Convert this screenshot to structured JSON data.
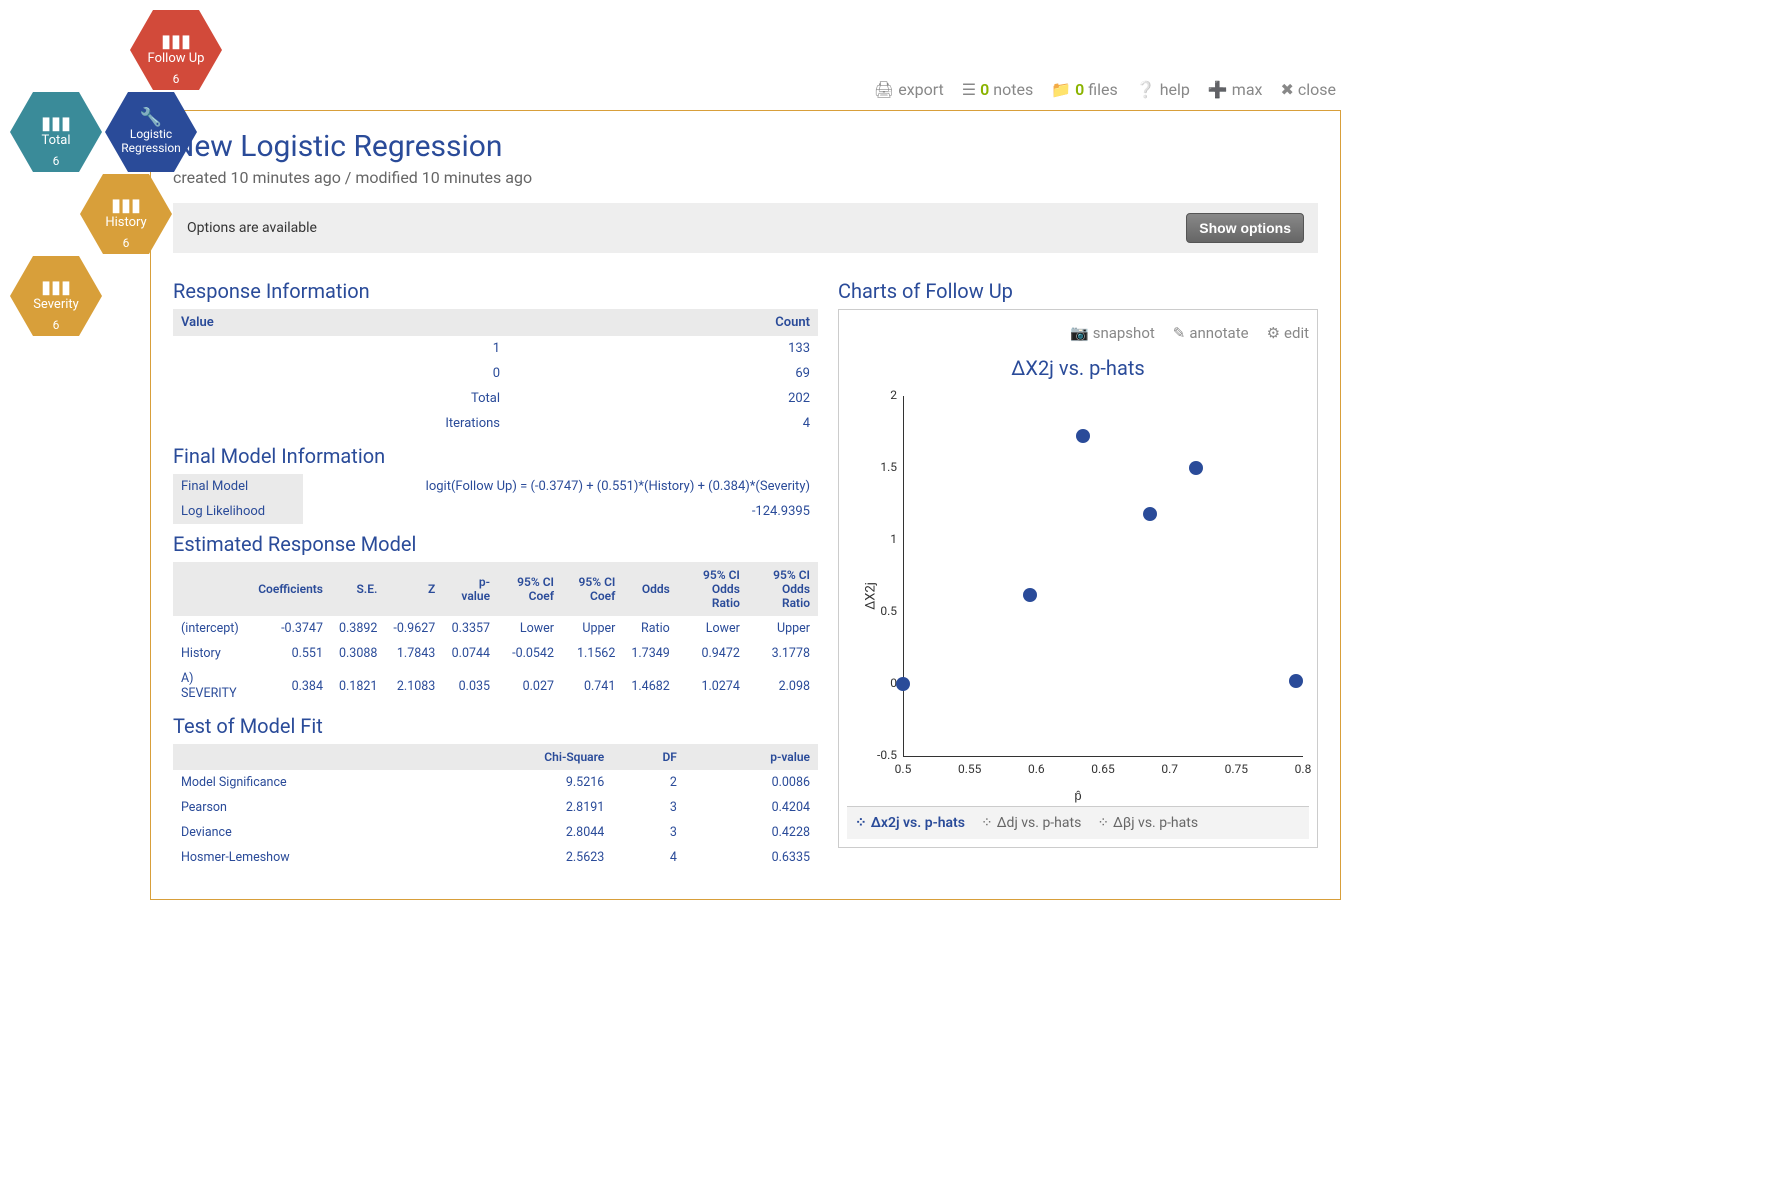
{
  "hex": {
    "followup": {
      "label": "Follow Up",
      "count": "6"
    },
    "total": {
      "label": "Total",
      "count": "6"
    },
    "logreg": {
      "label": "Logistic Regression"
    },
    "history": {
      "label": "History",
      "count": "6"
    },
    "severity": {
      "label": "Severity",
      "count": "6"
    }
  },
  "toolbar": {
    "export": "export",
    "notes_pre": "0",
    "notes": "notes",
    "files_pre": "0",
    "files": "files",
    "help": "help",
    "max": "max",
    "close": "close"
  },
  "title": "New Logistic Regression",
  "meta": "created 10 minutes ago / modified 10 minutes ago",
  "options_text": "Options are available",
  "show_options": "Show options",
  "sections": {
    "response": "Response Information",
    "final_model": "Final Model Information",
    "est": "Estimated Response Model",
    "fit": "Test of Model Fit",
    "charts": "Charts of Follow Up"
  },
  "response_info": {
    "headers": {
      "value": "Value",
      "count": "Count"
    },
    "rows": [
      {
        "value": "1",
        "count": "133"
      },
      {
        "value": "0",
        "count": "69"
      },
      {
        "value": "Total",
        "count": "202"
      },
      {
        "value": "Iterations",
        "count": "4"
      }
    ]
  },
  "final_model": {
    "fm_label": "Final Model",
    "fm_value": "logit(Follow Up) = (-0.3747) + (0.551)*(History) + (0.384)*(Severity)",
    "ll_label": "Log Likelihood",
    "ll_value": "-124.9395"
  },
  "est_headers": [
    "",
    "Coefficients",
    "S.E.",
    "Z",
    "p-value",
    "95% CI Coef",
    "95% CI Coef",
    "Odds",
    "95% CI Odds Ratio",
    "95% CI Odds Ratio"
  ],
  "est_rows": [
    [
      "(intercept)",
      "-0.3747",
      "0.3892",
      "-0.9627",
      "0.3357",
      "Lower",
      "Upper",
      "Ratio",
      "Lower",
      "Upper"
    ],
    [
      "History",
      "0.551",
      "0.3088",
      "1.7843",
      "0.0744",
      "-0.0542",
      "1.1562",
      "1.7349",
      "0.9472",
      "3.1778"
    ],
    [
      "A) SEVERITY",
      "0.384",
      "0.1821",
      "2.1083",
      "0.035",
      "0.027",
      "0.741",
      "1.4682",
      "1.0274",
      "2.098"
    ]
  ],
  "fit_headers": [
    "",
    "Chi-Square",
    "DF",
    "p-value"
  ],
  "fit_rows": [
    [
      "Model Significance",
      "9.5216",
      "2",
      "0.0086"
    ],
    [
      "Pearson",
      "2.8191",
      "3",
      "0.4204"
    ],
    [
      "Deviance",
      "2.8044",
      "3",
      "0.4228"
    ],
    [
      "Hosmer-Lemeshow",
      "2.5623",
      "4",
      "0.6335"
    ]
  ],
  "chart_actions": {
    "snapshot": "snapshot",
    "annotate": "annotate",
    "edit": "edit"
  },
  "chart_tabs": [
    "Δx2j vs. p-hats",
    "Δdj vs. p-hats",
    "Δβj vs. p-hats"
  ],
  "chart_data": {
    "type": "scatter",
    "title": "ΔX2j  vs. p-hats",
    "xlabel": "p̂",
    "ylabel": "ΔX2j",
    "xlim": [
      0.5,
      0.8
    ],
    "ylim": [
      -0.5,
      2.0
    ],
    "x": [
      0.5,
      0.595,
      0.635,
      0.685,
      0.72,
      0.795
    ],
    "y": [
      0.0,
      0.62,
      1.72,
      1.18,
      1.5,
      0.02
    ]
  }
}
